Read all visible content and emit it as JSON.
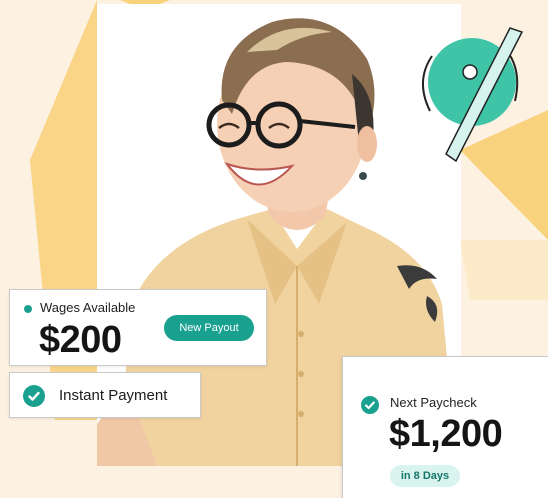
{
  "wages_card": {
    "label": "Wages Available",
    "amount": "$200",
    "button_label": "New Payout"
  },
  "instant_card": {
    "label": "Instant Payment"
  },
  "paycheck_card": {
    "label": "Next Paycheck",
    "amount": "$1,200",
    "badge": "in 8 Days"
  },
  "colors": {
    "accent": "#1aa08f",
    "background": "#fdf1e2",
    "shape_yellow": "#f9d27e",
    "badge_bg": "#d9f4ef"
  },
  "icons": [
    "check-circle-icon",
    "status-dot-icon",
    "speed-gauge-icon"
  ]
}
